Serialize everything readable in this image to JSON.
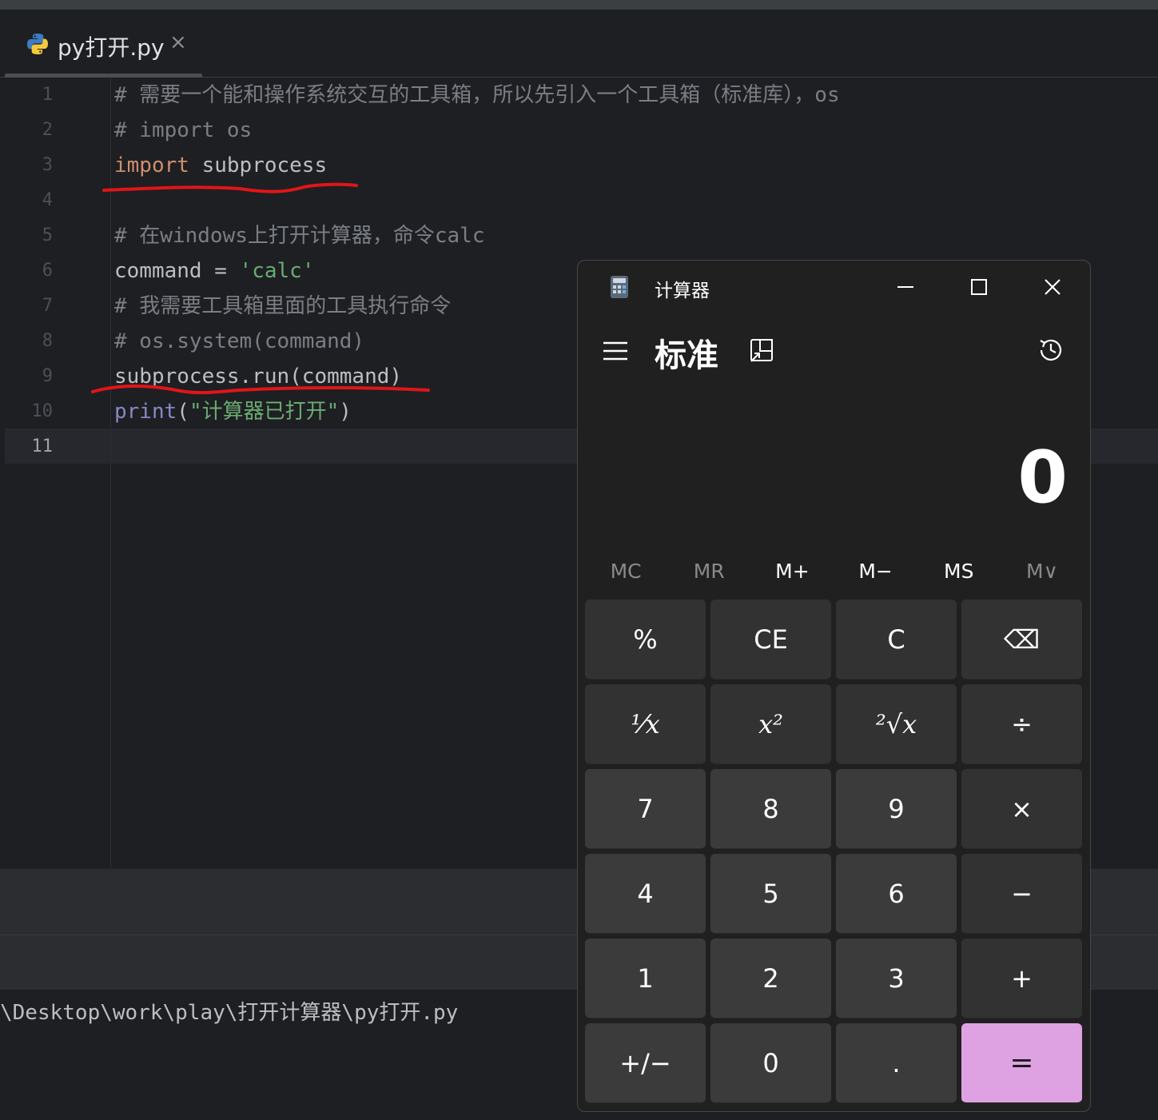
{
  "editor": {
    "tab": {
      "file_name": "py打开.py",
      "close_glyph": "×"
    },
    "lines": [
      {
        "num": "1",
        "parts": [
          {
            "cls": "cmt",
            "text": "# 需要一个能和操作系统交互的工具箱，所以先引入一个工具箱（标准库），os"
          }
        ]
      },
      {
        "num": "2",
        "parts": [
          {
            "cls": "cmt",
            "text": "# import os"
          }
        ]
      },
      {
        "num": "3",
        "parts": [
          {
            "cls": "kw",
            "text": "import"
          },
          {
            "cls": "",
            "text": " subprocess"
          }
        ]
      },
      {
        "num": "4",
        "parts": []
      },
      {
        "num": "5",
        "parts": [
          {
            "cls": "cmt",
            "text": "# 在windows上打开计算器，命令calc"
          }
        ]
      },
      {
        "num": "6",
        "parts": [
          {
            "cls": "",
            "text": "command = "
          },
          {
            "cls": "str",
            "text": "'calc'"
          }
        ]
      },
      {
        "num": "7",
        "parts": [
          {
            "cls": "cmt",
            "text": "# 我需要工具箱里面的工具执行命令"
          }
        ]
      },
      {
        "num": "8",
        "parts": [
          {
            "cls": "cmt",
            "text": "# os.system(command)"
          }
        ]
      },
      {
        "num": "9",
        "parts": [
          {
            "cls": "",
            "text": "subprocess.run(command)"
          }
        ]
      },
      {
        "num": "10",
        "parts": [
          {
            "cls": "bi",
            "text": "print"
          },
          {
            "cls": "",
            "text": "("
          },
          {
            "cls": "str",
            "text": "\"计算器已打开\""
          },
          {
            "cls": "",
            "text": ")"
          }
        ]
      },
      {
        "num": "11",
        "parts": []
      }
    ],
    "active_line": "11"
  },
  "terminal": {
    "path_line": "\\Desktop\\work\\play\\打开计算器\\py打开.py"
  },
  "annotation_color": "#e0151a",
  "calculator": {
    "window_title": "计算器",
    "mode": "标准",
    "display_value": "0",
    "memory": [
      {
        "label": "MC",
        "enabled": false
      },
      {
        "label": "MR",
        "enabled": false
      },
      {
        "label": "M+",
        "enabled": true
      },
      {
        "label": "M−",
        "enabled": true
      },
      {
        "label": "MS",
        "enabled": true
      },
      {
        "label": "M∨",
        "enabled": false
      }
    ],
    "keys": [
      {
        "label": "%",
        "kind": "fn",
        "name": "percent-button"
      },
      {
        "label": "CE",
        "kind": "fn",
        "name": "clear-entry-button"
      },
      {
        "label": "C",
        "kind": "fn",
        "name": "clear-button"
      },
      {
        "label": "⌫",
        "kind": "fn",
        "name": "backspace-button",
        "icon": "backspace-icon"
      },
      {
        "label": "⅟x",
        "kind": "fn",
        "name": "reciprocal-button",
        "serif": true
      },
      {
        "label": "x²",
        "kind": "fn",
        "name": "square-button",
        "serif": true
      },
      {
        "label": "²√x",
        "kind": "fn",
        "name": "square-root-button",
        "serif": true
      },
      {
        "label": "÷",
        "kind": "fn",
        "name": "divide-button"
      },
      {
        "label": "7",
        "kind": "num",
        "name": "digit-7-button"
      },
      {
        "label": "8",
        "kind": "num",
        "name": "digit-8-button"
      },
      {
        "label": "9",
        "kind": "num",
        "name": "digit-9-button"
      },
      {
        "label": "×",
        "kind": "fn",
        "name": "multiply-button"
      },
      {
        "label": "4",
        "kind": "num",
        "name": "digit-4-button"
      },
      {
        "label": "5",
        "kind": "num",
        "name": "digit-5-button"
      },
      {
        "label": "6",
        "kind": "num",
        "name": "digit-6-button"
      },
      {
        "label": "−",
        "kind": "fn",
        "name": "subtract-button"
      },
      {
        "label": "1",
        "kind": "num",
        "name": "digit-1-button"
      },
      {
        "label": "2",
        "kind": "num",
        "name": "digit-2-button"
      },
      {
        "label": "3",
        "kind": "num",
        "name": "digit-3-button"
      },
      {
        "label": "+",
        "kind": "fn",
        "name": "add-button"
      },
      {
        "label": "+/−",
        "kind": "num",
        "name": "negate-button"
      },
      {
        "label": "0",
        "kind": "num",
        "name": "digit-0-button"
      },
      {
        "label": ".",
        "kind": "num",
        "name": "decimal-button"
      },
      {
        "label": "=",
        "kind": "eq",
        "name": "equals-button"
      }
    ],
    "accent_color": "#dea2e3"
  }
}
